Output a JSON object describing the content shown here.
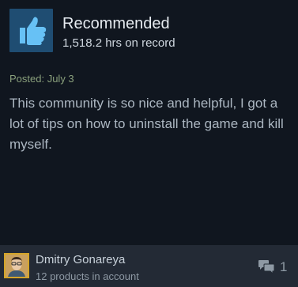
{
  "review": {
    "verdict": "Recommended",
    "hours": "1,518.2 hrs on record",
    "posted": "Posted: July 3",
    "text": "This community is so nice and helpful, I got a lot of tips on how to uninstall the game and kill myself."
  },
  "author": {
    "name": "Dmitry Gonareya",
    "products": "12 products in account"
  },
  "comments": {
    "count": "1"
  },
  "colors": {
    "background": "#10161f",
    "thumb_tile": "#1f4d72",
    "thumb": "#67c1f5",
    "posted_text": "#8aa07c",
    "author_bar": "#232a35",
    "avatar_border": "#d4a52a"
  },
  "icons": {
    "verdict": "thumbs-up-icon",
    "comment": "speech-bubbles-icon"
  }
}
